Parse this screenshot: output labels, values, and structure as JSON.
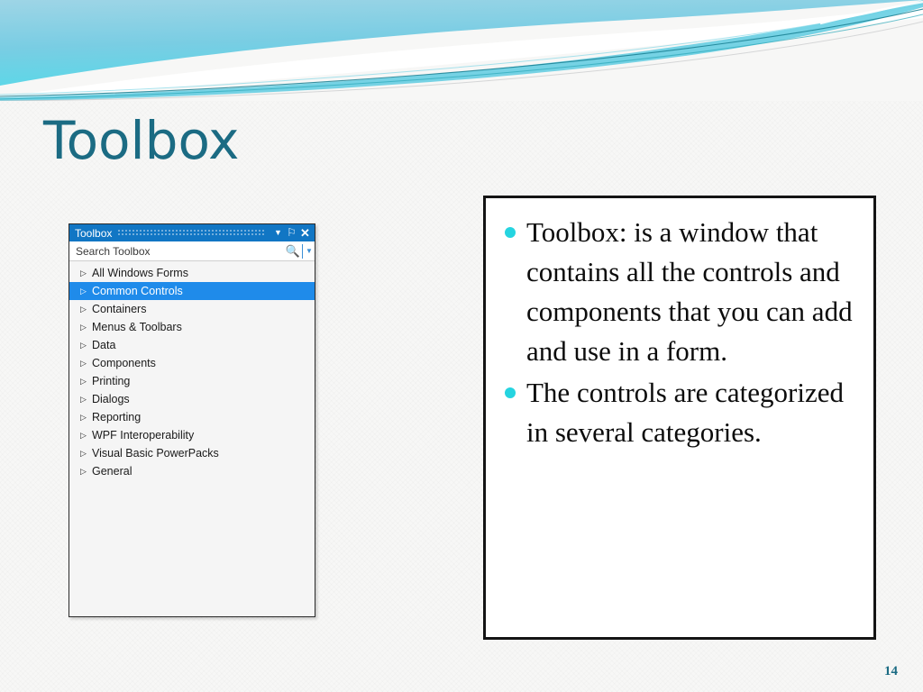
{
  "slide": {
    "title": "Toolbox",
    "page_number": "14",
    "accent_color": "#1b6b83",
    "bullet_color": "#25d4e0",
    "header_gradient_from": "#8ccfe4",
    "header_gradient_to": "#4fd9e8"
  },
  "toolbox": {
    "window_title": "Toolbox",
    "titlebar_buttons": [
      {
        "name": "chevron-down-icon",
        "glyph": "▼"
      },
      {
        "name": "pin-icon",
        "glyph": "⚐"
      },
      {
        "name": "close-icon",
        "glyph": "✕"
      }
    ],
    "search": {
      "placeholder": "Search Toolbox",
      "value": "",
      "icon": "search-icon",
      "dropdown_glyph": "▼"
    },
    "expander_glyph": "▷",
    "items": [
      {
        "label": "All Windows Forms",
        "selected": false
      },
      {
        "label": "Common Controls",
        "selected": true
      },
      {
        "label": "Containers",
        "selected": false
      },
      {
        "label": "Menus & Toolbars",
        "selected": false
      },
      {
        "label": "Data",
        "selected": false
      },
      {
        "label": "Components",
        "selected": false
      },
      {
        "label": "Printing",
        "selected": false
      },
      {
        "label": "Dialogs",
        "selected": false
      },
      {
        "label": "Reporting",
        "selected": false
      },
      {
        "label": "WPF Interoperability",
        "selected": false
      },
      {
        "label": "Visual Basic PowerPacks",
        "selected": false
      },
      {
        "label": "General",
        "selected": false
      }
    ]
  },
  "content": {
    "bullets": [
      "Toolbox: is a window that contains all the controls  and components that you can add and use in a form.",
      "The controls are categorized in several categories."
    ]
  }
}
